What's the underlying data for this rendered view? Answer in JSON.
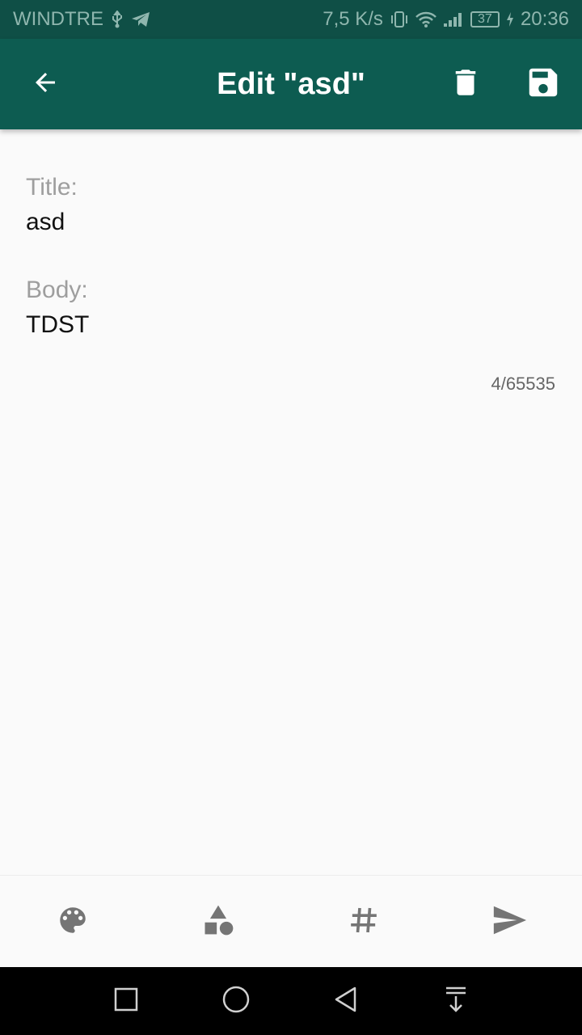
{
  "status_bar": {
    "carrier": "WINDTRE",
    "net_speed": "7,5 K/s",
    "battery_level": "37",
    "time": "20:36",
    "icons": [
      "usb-icon",
      "telegram-icon",
      "vibrate-icon",
      "wifi-icon",
      "signal-icon",
      "battery-icon",
      "charging-icon"
    ]
  },
  "app_bar": {
    "title": "Edit \"asd\"",
    "icons": [
      "back-arrow-icon",
      "delete-icon",
      "save-icon"
    ]
  },
  "form": {
    "title_label": "Title:",
    "title_value": "asd",
    "body_label": "Body:",
    "body_value": "TDST",
    "char_counter": "4/65535"
  },
  "bottom_toolbar": {
    "icons": [
      "palette-icon",
      "category-shapes-icon",
      "hashtag-icon",
      "send-icon"
    ]
  },
  "nav_bar": {
    "icons": [
      "recents-square-icon",
      "home-circle-icon",
      "back-triangle-icon",
      "notifications-pull-down-icon"
    ]
  },
  "colors": {
    "status_bar_bg": "#0f4f46",
    "app_bar_bg": "#0d5c51",
    "page_bg": "#fafafa",
    "toolbar_icon": "#757575",
    "nav_bar_bg": "#000000"
  }
}
